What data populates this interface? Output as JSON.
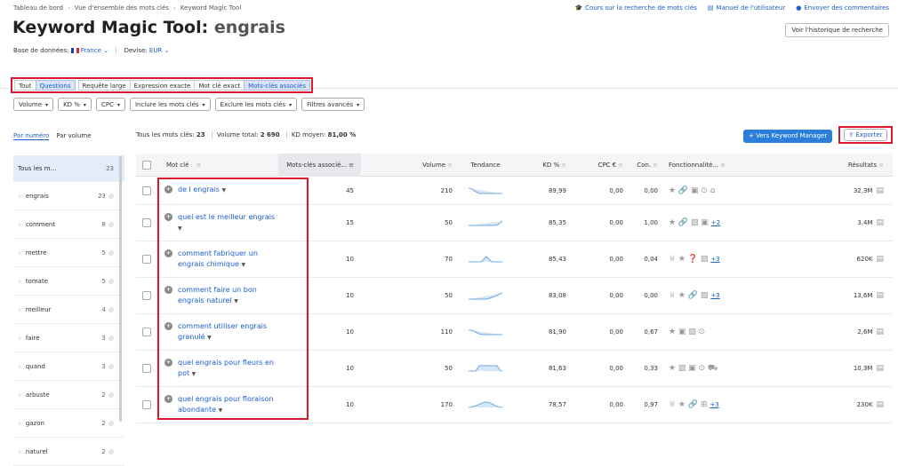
{
  "breadcrumb": [
    "Tableau de bord",
    "Vue d'ensemble des mots clés",
    "Keyword Magic Tool"
  ],
  "toplinks": [
    {
      "icon": "graduation-icon",
      "label": "Cours sur la recherche de mots clés"
    },
    {
      "icon": "book-icon",
      "label": "Manuel de l'utilisateur"
    },
    {
      "icon": "chat-icon",
      "label": "Envoyer des commentaires"
    }
  ],
  "title": {
    "tool": "Keyword Magic Tool:",
    "keyword": "engrais"
  },
  "history_button": "Voir l'historique de recherche",
  "database": {
    "label": "Base de données:",
    "country": "France",
    "currency_label": "Devise:",
    "currency": "EUR"
  },
  "match_tabs": [
    "Tout",
    "Questions",
    "Requête large",
    "Expression exacte",
    "Mot clé exact",
    "Mots-clés associés"
  ],
  "filters": [
    "Volume",
    "KD %",
    "CPC",
    "Inclure les mots clés",
    "Exclure les mots clés",
    "Filtres avancés"
  ],
  "sidebar": {
    "tabs": [
      "Par numéro",
      "Par volume"
    ],
    "first": {
      "label": "Tous les m...",
      "count": "23"
    },
    "items": [
      {
        "label": "engrais",
        "count": "23"
      },
      {
        "label": "comment",
        "count": "8"
      },
      {
        "label": "mettre",
        "count": "5"
      },
      {
        "label": "tomate",
        "count": "5"
      },
      {
        "label": "meilleur",
        "count": "4"
      },
      {
        "label": "faire",
        "count": "3"
      },
      {
        "label": "quand",
        "count": "3"
      },
      {
        "label": "arbuste",
        "count": "2"
      },
      {
        "label": "gazon",
        "count": "2"
      },
      {
        "label": "naturel",
        "count": "2"
      }
    ]
  },
  "summary": {
    "total_label": "Tous les mots clés:",
    "total": "23",
    "volume_label": "Volume total:",
    "volume": "2 690",
    "kd_label": "KD moyen:",
    "kd": "81,00 %"
  },
  "keyword_manager_button": "+  Vers Keyword Manager",
  "export_button": "Exporter",
  "table": {
    "headers": {
      "keyword": "Mot clé",
      "related": "Mots-clés associé...",
      "volume": "Volume",
      "trend": "Tendance",
      "kd": "KD %",
      "cpc": "CPC €",
      "com": "Con.",
      "features": "Fonctionnalité...",
      "results": "Résultats"
    },
    "rows": [
      {
        "keyword": "de l engrais",
        "related": "45",
        "volume": "210",
        "kd": "89,99",
        "cpc": "0,00",
        "com": "0,00",
        "features": "★ 🔗 ▣ ⊙ ⌂",
        "more": "",
        "results": "32,3M"
      },
      {
        "keyword": "quel est le meilleur engrais",
        "related": "15",
        "volume": "50",
        "kd": "85,35",
        "cpc": "0,00",
        "com": "1,00",
        "features": "★ 🔗 ▨ ▣",
        "more": "+2",
        "results": "3,4M"
      },
      {
        "keyword": "comment fabriquer un engrais chimique",
        "related": "10",
        "volume": "70",
        "kd": "85,43",
        "cpc": "0,00",
        "com": "0,04",
        "features": "♕ ★ ❓ ▨",
        "more": "+3",
        "results": "620K"
      },
      {
        "keyword": "comment faire un bon engrais naturel",
        "related": "10",
        "volume": "50",
        "kd": "83,08",
        "cpc": "0,00",
        "com": "0,00",
        "features": "♕ ★ 🔗 ▨",
        "more": "+3",
        "results": "13,6M"
      },
      {
        "keyword": "comment utiliser engrais granulé",
        "related": "10",
        "volume": "110",
        "kd": "81,90",
        "cpc": "0,00",
        "com": "0,67",
        "features": "★ ▣ ▨ ⊙",
        "more": "",
        "results": "2,6M"
      },
      {
        "keyword": "quel engrais pour fleurs en pot",
        "related": "10",
        "volume": "50",
        "kd": "81,63",
        "cpc": "0,00",
        "com": "0,33",
        "features": "★ ▨ ▣ ⊙ ⛟",
        "more": "",
        "results": "10,3M"
      },
      {
        "keyword": "quel engrais pour floraison abondante",
        "related": "10",
        "volume": "170",
        "kd": "78,57",
        "cpc": "0,00",
        "com": "0,97",
        "features": "♕ ★ 🔗 ⊞",
        "more": "+3",
        "results": "230K"
      }
    ]
  }
}
